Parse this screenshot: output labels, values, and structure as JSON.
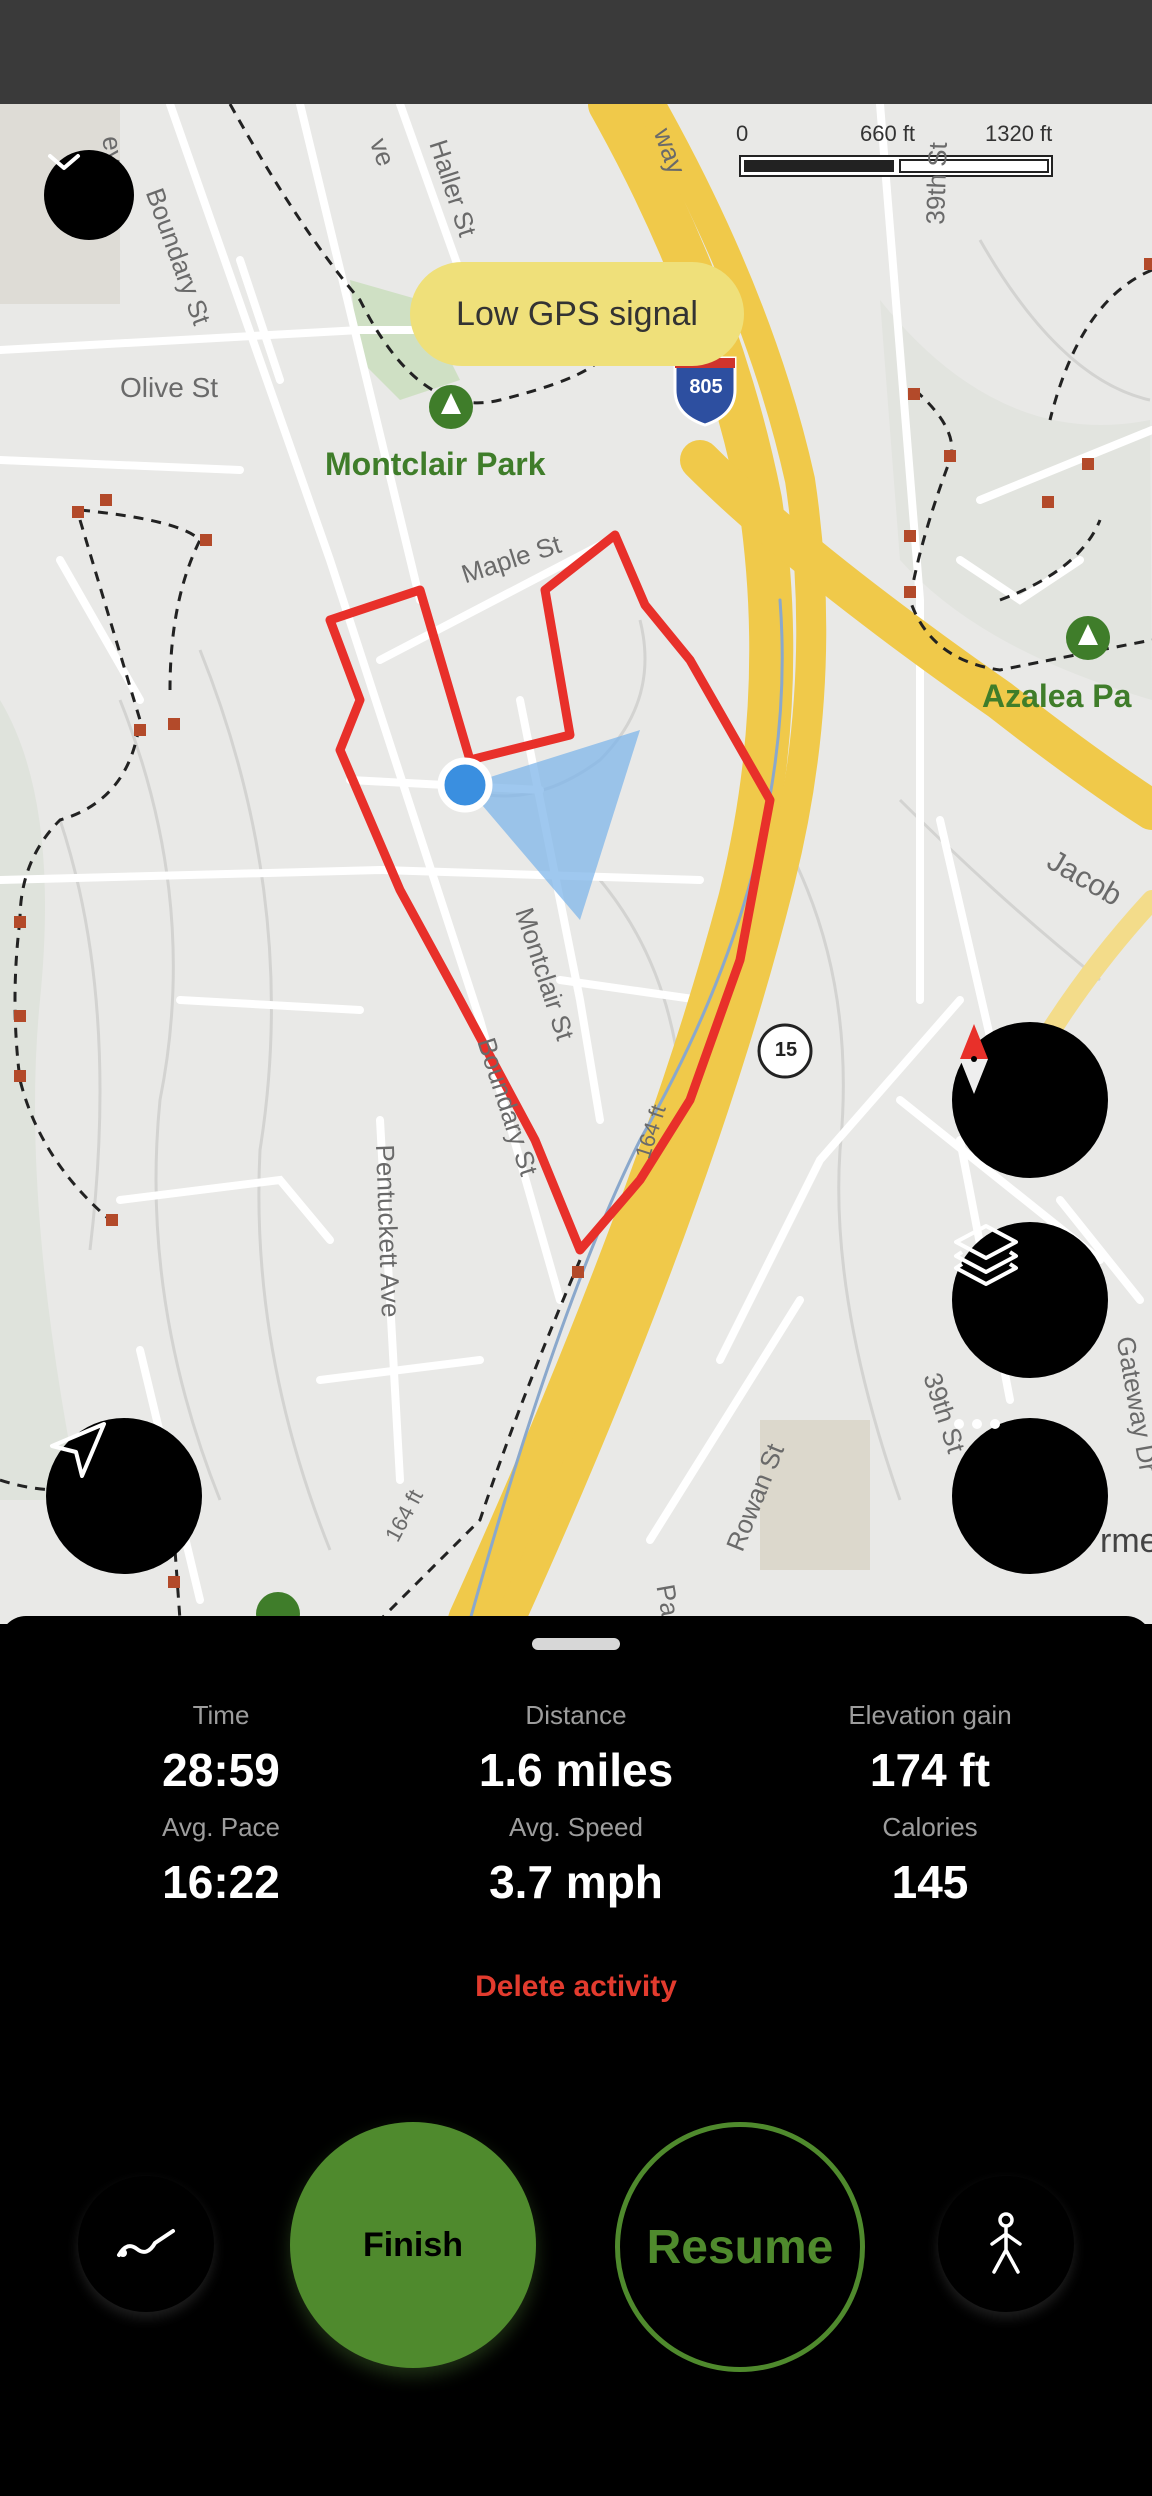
{
  "map": {
    "toast": "Low GPS signal",
    "scale": {
      "labels": [
        "0",
        "660 ft",
        "1320 ft"
      ]
    },
    "streets": [
      "Boundary St",
      "Haller St",
      "Olive St",
      "Maple St",
      "Montclair St",
      "Boundary St",
      "Pentuckett Ave",
      "Rowan St",
      "39th St",
      "39th St",
      "Jacob",
      "Gateway Dr",
      "164 ft",
      "164 ft",
      "Pa",
      "ve",
      "ey St",
      "way",
      "rme"
    ],
    "parks": [
      "Montclair Park",
      "Azalea Pa"
    ],
    "shields": {
      "interstate": "805",
      "route": "15"
    }
  },
  "colors": {
    "route": "#e8302a",
    "highway": "#f0c94a",
    "park": "#3f7d2a",
    "accent_green": "#4f8a2d",
    "delete_red": "#e23b2e",
    "toast_bg": "#efe07a"
  },
  "icons": {
    "collapse": "chevron-down-icon",
    "compass": "compass-icon",
    "layers": "layers-icon",
    "more": "more-icon",
    "locate": "navigation-arrow-icon",
    "stats": "chart-line-icon",
    "activity": "hiking-person-icon"
  },
  "stats": [
    {
      "label": "Time",
      "value": "28:59"
    },
    {
      "label": "Distance",
      "value": "1.6 miles"
    },
    {
      "label": "Elevation gain",
      "value": "174 ft"
    },
    {
      "label": "Avg. Pace",
      "value": "16:22"
    },
    {
      "label": "Avg. Speed",
      "value": "3.7 mph"
    },
    {
      "label": "Calories",
      "value": "145"
    }
  ],
  "actions": {
    "delete": "Delete activity",
    "finish": "Finish",
    "resume": "Resume"
  }
}
